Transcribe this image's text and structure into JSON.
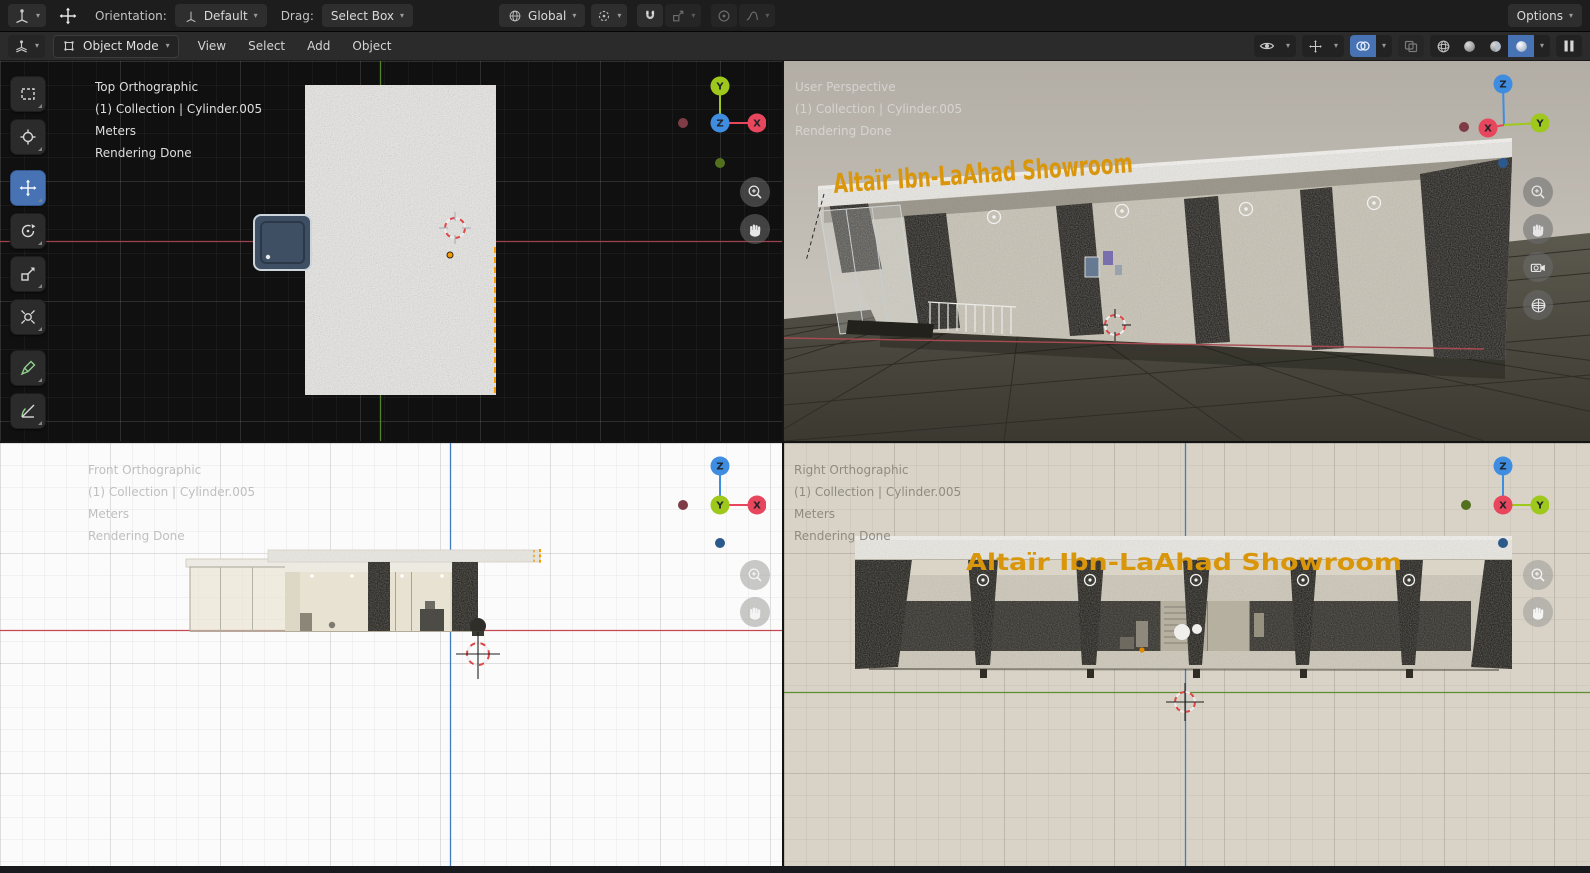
{
  "topbar": {
    "orientation_label": "Orientation:",
    "orientation_value": "Default",
    "drag_label": "Drag:",
    "drag_value": "Select Box",
    "transform_space_value": "Global",
    "options_label": "Options"
  },
  "viewport_header": {
    "mode_value": "Object Mode",
    "menus": [
      "View",
      "Select",
      "Add",
      "Object"
    ]
  },
  "axes": {
    "x": "X",
    "y": "Y",
    "z": "Z"
  },
  "viewports": {
    "top_left": {
      "view_name": "Top Orthographic",
      "collection": "(1) Collection | Cylinder.005",
      "units": "Meters",
      "status": "Rendering Done"
    },
    "top_right": {
      "view_name": "User Perspective",
      "collection": "(1) Collection | Cylinder.005",
      "status": "Rendering Done",
      "scene_text": "Altaïr Ibn-LaAhad Showroom"
    },
    "bottom_left": {
      "view_name": "Front Orthographic",
      "collection": "(1) Collection | Cylinder.005",
      "units": "Meters",
      "status": "Rendering Done"
    },
    "bottom_right": {
      "view_name": "Right Orthographic",
      "collection": "(1) Collection | Cylinder.005",
      "units": "Meters",
      "status": "Rendering Done",
      "scene_text": "Altaïr Ibn-LaAhad Showroom"
    }
  },
  "icons": {
    "dropdown_arrow": "▾"
  },
  "colors": {
    "accent_blue": "#4772b3",
    "axis_x": "#e8465c",
    "axis_y": "#9ec91c",
    "axis_z": "#3f8de0",
    "selection_orange": "#f79c00",
    "showroom_text_orange": "#d9960a"
  }
}
